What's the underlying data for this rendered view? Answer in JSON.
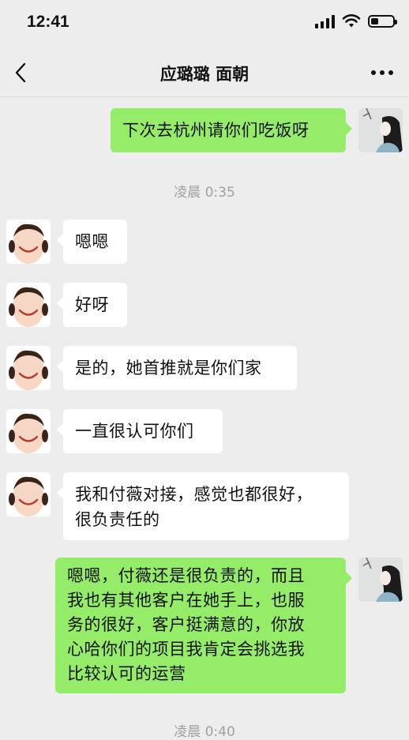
{
  "status": {
    "time": "12:41",
    "battery_level": 0.35
  },
  "nav": {
    "title": "应璐璐 面朝"
  },
  "timestamps": [
    "凌晨 0:35",
    "凌晨 0:40"
  ],
  "messages": [
    {
      "side": "out",
      "text": "下次去杭州请你们吃饭呀"
    },
    {
      "side": "in",
      "text": "嗯嗯"
    },
    {
      "side": "in",
      "text": "好呀"
    },
    {
      "side": "in",
      "text": "是的，她首推就是你们家"
    },
    {
      "side": "in",
      "text": "一直很认可你们"
    },
    {
      "side": "in",
      "text": "我和付薇对接，感觉也都很好，\n很负责任的"
    },
    {
      "side": "out",
      "text": "嗯嗯，付薇还是很负责的，而且\n我也有其他客户在她手上，也服\n务的很好，客户挺满意的，你放\n心哈你们的项目我肯定会挑选我\n比较认可的运营"
    }
  ],
  "colors": {
    "background": "#ededed",
    "outgoing_bubble": "#95ec69",
    "incoming_bubble": "#ffffff",
    "timestamp": "#a0a0a0"
  },
  "icons": {
    "back": "chevron-left-icon",
    "more": "more-dots-icon",
    "signal": "signal-icon",
    "wifi": "wifi-icon",
    "battery": "battery-icon"
  }
}
